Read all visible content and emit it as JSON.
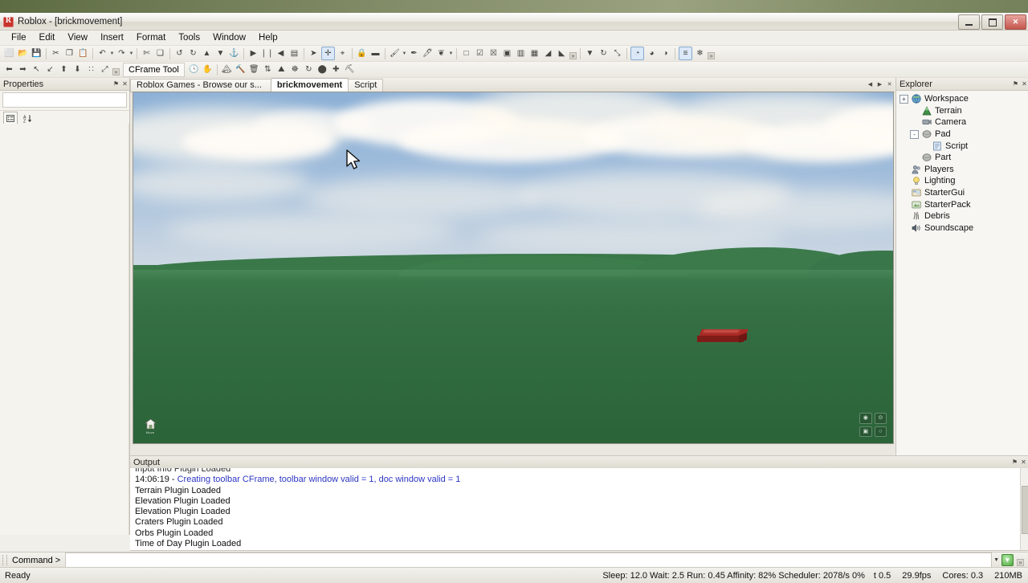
{
  "window": {
    "title": "Roblox - [brickmovement]",
    "app_icon": "roblox-icon",
    "buttons": {
      "minimize": "minimize",
      "maximize": "restore",
      "close": "close"
    }
  },
  "menubar": {
    "items": [
      "File",
      "Edit",
      "View",
      "Insert",
      "Format",
      "Tools",
      "Window",
      "Help"
    ]
  },
  "toolbars": {
    "row1": [
      {
        "name": "new-file-icon",
        "glyph": "⬜"
      },
      {
        "name": "open-folder-icon",
        "glyph": "📂"
      },
      {
        "name": "save-icon",
        "glyph": "💾"
      },
      {
        "sep": true
      },
      {
        "name": "cut-icon",
        "glyph": "✂"
      },
      {
        "name": "copy-icon",
        "glyph": "❐"
      },
      {
        "name": "paste-icon",
        "glyph": "📋"
      },
      {
        "sep": true
      },
      {
        "name": "undo-icon",
        "glyph": "↶",
        "dropdown": true
      },
      {
        "name": "redo-icon",
        "glyph": "↷",
        "dropdown": true
      },
      {
        "sep": true
      },
      {
        "name": "cut-disabled-icon",
        "glyph": "✄"
      },
      {
        "name": "copy-disabled-icon",
        "glyph": "❑"
      },
      {
        "sep": true
      },
      {
        "name": "rotate-left-icon",
        "glyph": "↺"
      },
      {
        "name": "rotate-right-icon",
        "glyph": "↻"
      },
      {
        "name": "move-up-icon",
        "glyph": "▲"
      },
      {
        "name": "move-down-icon",
        "glyph": "▼"
      },
      {
        "name": "anchor-icon",
        "glyph": "⚓"
      },
      {
        "sep": true
      },
      {
        "name": "play-icon",
        "glyph": "▶"
      },
      {
        "name": "pause-icon",
        "glyph": "❘❘"
      },
      {
        "name": "stop-icon",
        "glyph": "◀"
      },
      {
        "name": "run-options-icon",
        "glyph": "▤"
      },
      {
        "sep": true
      },
      {
        "name": "select-tool-icon",
        "glyph": "➤"
      },
      {
        "name": "move-tool-icon",
        "glyph": "✛",
        "active": true
      },
      {
        "name": "scale-tool-icon",
        "glyph": "⌖"
      },
      {
        "sep": true
      },
      {
        "name": "lock-icon",
        "glyph": "🔒"
      },
      {
        "name": "surface-icon",
        "glyph": "▬"
      },
      {
        "sep": true
      },
      {
        "name": "material-icon",
        "glyph": "🖌",
        "dropdown": true
      },
      {
        "name": "color-picker-icon",
        "glyph": "✒",
        "dropdown": false
      },
      {
        "name": "eyedropper-icon",
        "glyph": "🖊"
      },
      {
        "name": "group-icon",
        "glyph": "❦",
        "dropdown": true
      },
      {
        "sep": true
      },
      {
        "name": "part-block-icon",
        "glyph": "□"
      },
      {
        "name": "part-check-icon",
        "glyph": "☑"
      },
      {
        "name": "part-cross-icon",
        "glyph": "☒"
      },
      {
        "name": "part-filled-icon",
        "glyph": "▣"
      },
      {
        "name": "part-layers-icon",
        "glyph": "▥"
      },
      {
        "name": "part-panel-icon",
        "glyph": "▦"
      },
      {
        "name": "wedge-icon",
        "glyph": "◢"
      },
      {
        "name": "wedge-yellow-icon",
        "glyph": "◣"
      },
      {
        "more": true
      },
      {
        "sep": true
      },
      {
        "name": "cone-icon",
        "glyph": "▼"
      },
      {
        "name": "rotate-icon",
        "glyph": "↻"
      },
      {
        "name": "resize-icon",
        "glyph": "⤡"
      },
      {
        "sep": true
      },
      {
        "name": "studio-tool-1-icon",
        "glyph": "◔",
        "active": true
      },
      {
        "name": "studio-tool-2-icon",
        "glyph": "◕"
      },
      {
        "name": "studio-tool-3-icon",
        "glyph": "◑"
      },
      {
        "sep": true
      },
      {
        "name": "script-editor-icon",
        "glyph": "≡",
        "active": true
      },
      {
        "name": "effects-icon",
        "glyph": "❄"
      },
      {
        "more": true
      }
    ],
    "row2": [
      {
        "name": "arrow-left-icon",
        "glyph": "⬅"
      },
      {
        "name": "arrow-right-icon",
        "glyph": "➡"
      },
      {
        "name": "arrow-up-left-icon",
        "glyph": "↖"
      },
      {
        "name": "arrow-down-left-icon",
        "glyph": "↙"
      },
      {
        "name": "arrow-up-icon",
        "glyph": "⬆"
      },
      {
        "name": "arrow-down-icon",
        "glyph": "⬇"
      },
      {
        "name": "grid-snap-icon",
        "glyph": "∷"
      },
      {
        "name": "collapse-icon",
        "glyph": "⤢"
      },
      {
        "more": true
      },
      {
        "label": "CFrame Tool",
        "name": "cframe-tool-label"
      },
      {
        "name": "clock-icon",
        "glyph": "🕓"
      },
      {
        "name": "hand-icon",
        "glyph": "✋"
      },
      {
        "sep": true
      },
      {
        "name": "terrain-image-icon",
        "glyph": "🏔"
      },
      {
        "name": "hammer-icon",
        "glyph": "🔨"
      },
      {
        "name": "trash-icon",
        "glyph": "🗑"
      },
      {
        "name": "elevation-icon",
        "glyph": "⇅"
      },
      {
        "name": "mountain-icon",
        "glyph": "⛰"
      },
      {
        "name": "craters-icon",
        "glyph": "☸"
      },
      {
        "name": "smooth-icon",
        "glyph": "↻"
      },
      {
        "name": "orbs-icon",
        "glyph": "⬤"
      },
      {
        "name": "add-icon",
        "glyph": "✚"
      },
      {
        "name": "plugin-icon",
        "glyph": "⛏"
      }
    ]
  },
  "properties_panel": {
    "title": "Properties",
    "pin_glyph": "⚑",
    "close_glyph": "✕",
    "toolbar_buttons": [
      {
        "name": "categorized-view-button",
        "glyph": "∷"
      },
      {
        "name": "alphabetical-sort-button",
        "glyph": "↓"
      }
    ]
  },
  "tabs": {
    "items": [
      {
        "label": "Roblox Games - Browse our s...",
        "active": false,
        "name": "tab-roblox-games"
      },
      {
        "label": "brickmovement",
        "active": true,
        "name": "tab-brickmovement"
      },
      {
        "label": "Script",
        "active": false,
        "name": "tab-script"
      }
    ],
    "nav_buttons": [
      "◀",
      "▶",
      "✕"
    ]
  },
  "viewport": {
    "home_label": "Move",
    "nav_buttons": [
      "◉",
      "⊙",
      "▣",
      "○"
    ],
    "brick_color": "#a82a25",
    "ground_color": "#357044",
    "sky_color": "#8cb0d6"
  },
  "explorer": {
    "title": "Explorer",
    "pin_glyph": "⚑",
    "close_glyph": "✕",
    "nodes": [
      {
        "label": "Workspace",
        "depth": 0,
        "expander": "+",
        "icon": "workspace-icon",
        "name": "explorer-node-workspace"
      },
      {
        "label": "Terrain",
        "depth": 1,
        "expander": "",
        "icon": "terrain-icon",
        "name": "explorer-node-terrain"
      },
      {
        "label": "Camera",
        "depth": 1,
        "expander": "",
        "icon": "camera-icon",
        "name": "explorer-node-camera"
      },
      {
        "label": "Pad",
        "depth": 1,
        "expander": "-",
        "icon": "part-icon",
        "name": "explorer-node-pad"
      },
      {
        "label": "Script",
        "depth": 2,
        "expander": "",
        "icon": "script-icon",
        "name": "explorer-node-script"
      },
      {
        "label": "Part",
        "depth": 1,
        "expander": "",
        "icon": "part-icon",
        "name": "explorer-node-part"
      },
      {
        "label": "Players",
        "depth": 0,
        "expander": "",
        "icon": "players-icon",
        "name": "explorer-node-players"
      },
      {
        "label": "Lighting",
        "depth": 0,
        "expander": "",
        "icon": "lighting-icon",
        "name": "explorer-node-lighting"
      },
      {
        "label": "StarterGui",
        "depth": 0,
        "expander": "",
        "icon": "startergui-icon",
        "name": "explorer-node-startergui"
      },
      {
        "label": "StarterPack",
        "depth": 0,
        "expander": "",
        "icon": "starterpack-icon",
        "name": "explorer-node-starterpack"
      },
      {
        "label": "Debris",
        "depth": 0,
        "expander": "",
        "icon": "debris-icon",
        "name": "explorer-node-debris"
      },
      {
        "label": "Soundscape",
        "depth": 0,
        "expander": "",
        "icon": "soundscape-icon",
        "name": "explorer-node-soundscape"
      }
    ]
  },
  "output": {
    "title": "Output",
    "pin_glyph": "⚑",
    "close_glyph": "✕",
    "lines": [
      {
        "text": "Input Info Plugin Loaded",
        "color": "black",
        "clipped": true
      },
      {
        "timestamp": "14:06:19 - ",
        "text": "Creating toolbar CFrame, toolbar window valid = 1, doc window valid = 1",
        "color": "blue"
      },
      {
        "text": "Terrain Plugin Loaded",
        "color": "black"
      },
      {
        "text": "Elevation Plugin Loaded",
        "color": "black"
      },
      {
        "text": "Elevation Plugin Loaded",
        "color": "black"
      },
      {
        "text": "Craters Plugin Loaded",
        "color": "black"
      },
      {
        "text": "Orbs Plugin Loaded",
        "color": "black"
      },
      {
        "text": "Time of Day Plugin Loaded",
        "color": "black"
      }
    ]
  },
  "command_bar": {
    "label": "Command >",
    "value": "",
    "caret_glyph": "▼",
    "run_glyph": "▼"
  },
  "statusbar": {
    "ready": "Ready",
    "perf": "Sleep: 12.0 Wait: 2.5 Run: 0.45 Affinity: 82% Scheduler: 2078/s 0%",
    "time": "t 0.5",
    "fps": "29.9fps",
    "cores": "Cores: 0.3",
    "memory": "210MB"
  }
}
